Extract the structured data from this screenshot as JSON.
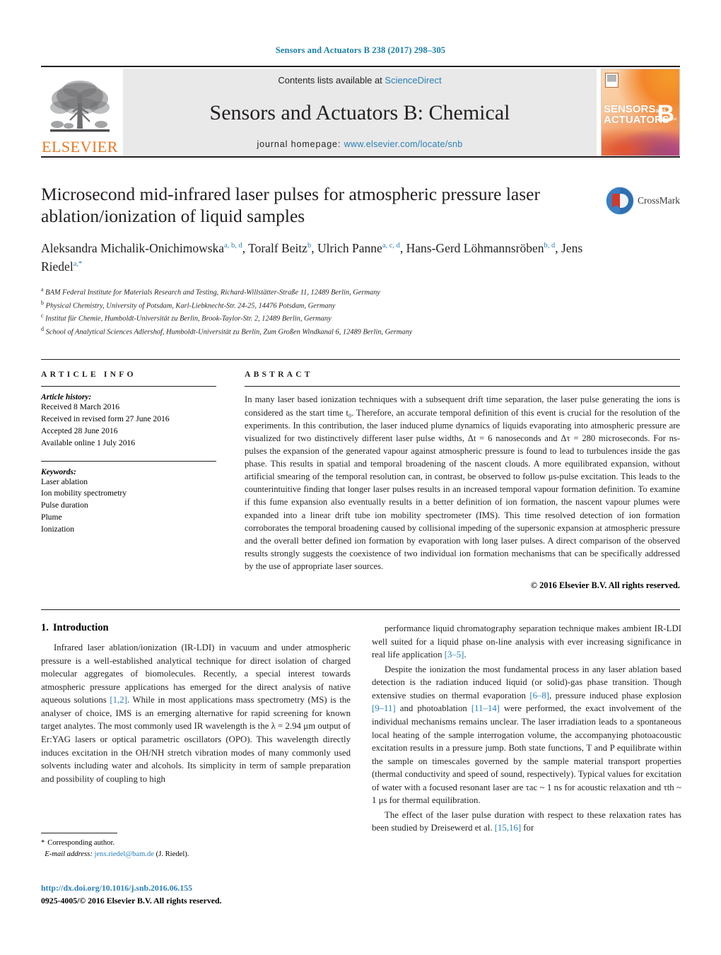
{
  "running_head": "Sensors and Actuators B 238 (2017) 298–305",
  "masthead": {
    "publisher_name": "ELSEVIER",
    "contents_prefix": "Contents lists available at ",
    "contents_link": "ScienceDirect",
    "journal_title": "Sensors and Actuators B: Chemical",
    "homepage_prefix": "journal homepage: ",
    "homepage_url": "www.elsevier.com/locate/snb",
    "cover_line1": "SENSORS",
    "cover_and": "and",
    "cover_line2": "ACTUATORS",
    "cover_letter": "B",
    "cover_sub": "Chemical"
  },
  "article": {
    "title": "Microsecond mid-infrared laser pulses for atmospheric pressure laser ablation/ionization of liquid samples",
    "crossmark_label": "CrossMark",
    "authors": [
      {
        "name": "Aleksandra Michalik-Onichimowska",
        "sup": "a, b, d",
        "sep": ", "
      },
      {
        "name": "Toralf Beitz",
        "sup": "b",
        "sep": ", "
      },
      {
        "name": "Ulrich Panne",
        "sup": "a, c, d",
        "sep": ","
      },
      {
        "name": "Hans-Gerd Löhmannsröben",
        "sup": "b, d",
        "sep": ", "
      },
      {
        "name": "Jens Riedel",
        "sup": "a,*",
        "sep": ""
      }
    ],
    "affiliations": [
      {
        "sup": "a",
        "text": "BAM Federal Institute for Materials Research and Testing, Richard-Willstätter-Straße 11, 12489 Berlin, Germany"
      },
      {
        "sup": "b",
        "text": "Physical Chemistry, University of Potsdam, Karl-Liebknecht-Str. 24-25, 14476 Potsdam, Germany"
      },
      {
        "sup": "c",
        "text": "Institut für Chemie, Humboldt-Universität zu Berlin, Brook-Taylor-Str. 2, 12489 Berlin, Germany"
      },
      {
        "sup": "d",
        "text": "School of Analytical Sciences Adlershof, Humboldt-Universität zu Berlin, Zum Großen Windkanal 6, 12489 Berlin, Germany"
      }
    ]
  },
  "article_info": {
    "heading": "ARTICLE INFO",
    "history_label": "Article history:",
    "history": [
      "Received 8 March 2016",
      "Received in revised form 27 June 2016",
      "Accepted 28 June 2016",
      "Available online 1 July 2016"
    ],
    "keywords_label": "Keywords:",
    "keywords": [
      "Laser ablation",
      "Ion mobility spectrometry",
      "Pulse duration",
      "Plume",
      "Ionization"
    ]
  },
  "abstract": {
    "heading": "ABSTRACT",
    "text": "In many laser based ionization techniques with a subsequent drift time separation, the laser pulse generating the ions is considered as the start time t₀. Therefore, an accurate temporal definition of this event is crucial for the resolution of the experiments. In this contribution, the laser induced plume dynamics of liquids evaporating into atmospheric pressure are visualized for two distinctively different laser pulse widths, Δt = 6 nanoseconds and Δτ = 280 microseconds. For ns-pulses the expansion of the generated vapour against atmospheric pressure is found to lead to turbulences inside the gas phase. This results in spatial and temporal broadening of the nascent clouds. A more equilibrated expansion, without artificial smearing of the temporal resolution can, in contrast, be observed to follow μs-pulse excitation. This leads to the counterintuitive finding that longer laser pulses results in an increased temporal vapour formation definition. To examine if this fume expansion also eventually results in a better definition of ion formation, the nascent vapour plumes were expanded into a linear drift tube ion mobility spectrometer (IMS). This time resolved detection of ion formation corroborates the temporal broadening caused by collisional impeding of the supersonic expansion at atmospheric pressure and the overall better defined ion formation by evaporation with long laser pulses. A direct comparison of the observed results strongly suggests the coexistence of two individual ion formation mechanisms that can be specifically addressed by the use of appropriate laser sources.",
    "copyright": "© 2016 Elsevier B.V. All rights reserved."
  },
  "introduction": {
    "number": "1.",
    "title": "Introduction",
    "left_paragraphs": [
      "Infrared laser ablation/ionization (IR-LDI) in vacuum and under atmospheric pressure is a well-established analytical technique for direct isolation of charged molecular aggregates of biomolecules. Recently, a special interest towards atmospheric pressure applications has emerged for the direct analysis of native aqueous solutions [1,2]. While in most applications mass spectrometry (MS) is the analyser of choice, IMS is an emerging alternative for rapid screening for known target analytes. The most commonly used IR wavelength is the λ = 2.94 μm output of Er:YAG lasers or optical parametric oscillators (OPO). This wavelength directly induces excitation in the OH/NH stretch vibration modes of many commonly used solvents including water and alcohols. Its simplicity in term of sample preparation and possibility of coupling to high"
    ],
    "right_paragraphs": [
      "performance liquid chromatography separation technique makes ambient IR-LDI well suited for a liquid phase on-line analysis with ever increasing significance in real life application [3–5].",
      "Despite the ionization the most fundamental process in any laser ablation based detection is the radiation induced liquid (or solid)-gas phase transition. Though extensive studies on thermal evaporation [6–8], pressure induced phase explosion [9–11] and photoablation [11–14] were performed, the exact involvement of the individual mechanisms remains unclear. The laser irradiation leads to a spontaneous local heating of the sample interrogation volume, the accompanying photoacoustic excitation results in a pressure jump. Both state functions, T and P equilibrate within the sample on timescales governed by the sample material transport properties (thermal conductivity and speed of sound, respectively). Typical values for excitation of water with a focused resonant laser are τac ~ 1 ns for acoustic relaxation and τth ~ 1 μs for thermal equilibration.",
      "The effect of the laser pulse duration with respect to these relaxation rates has been studied by Dreisewerd et al. [15,16] for"
    ]
  },
  "footer": {
    "corresponding_marker": "*",
    "corresponding_label": "Corresponding author.",
    "email_label": "E-mail address:",
    "email": "jens.riedel@bam.de",
    "email_owner": "(J. Riedel).",
    "doi": "http://dx.doi.org/10.1016/j.snb.2016.06.155",
    "issn": "0925-4005/© 2016 Elsevier B.V. All rights reserved."
  },
  "colors": {
    "link": "#2a7fb8",
    "elsevier_orange": "#e87722",
    "banner_bg": "#e9e9e9"
  }
}
